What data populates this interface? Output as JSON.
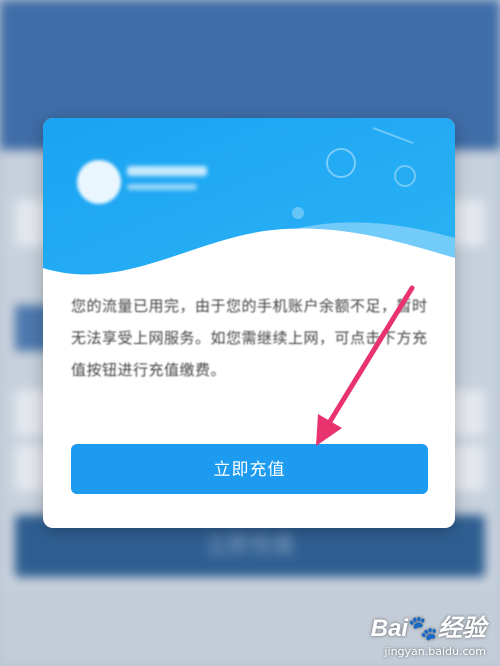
{
  "background": {
    "header_title": "",
    "button_label": "立即充值"
  },
  "dialog": {
    "message": "您的流量已用完，由于您的手机账户余额不足，暂时无法享受上网服务。如您需继续上网，可点击下方充值按钮进行充值缴费。",
    "button_label": "立即充值"
  },
  "watermark": {
    "brand": "Bai",
    "paw": "🐾",
    "brand_suffix": "经验",
    "url": "jingyan.baidu.com"
  },
  "colors": {
    "accent": "#1c9bf0",
    "arrow": "#e8336f"
  }
}
